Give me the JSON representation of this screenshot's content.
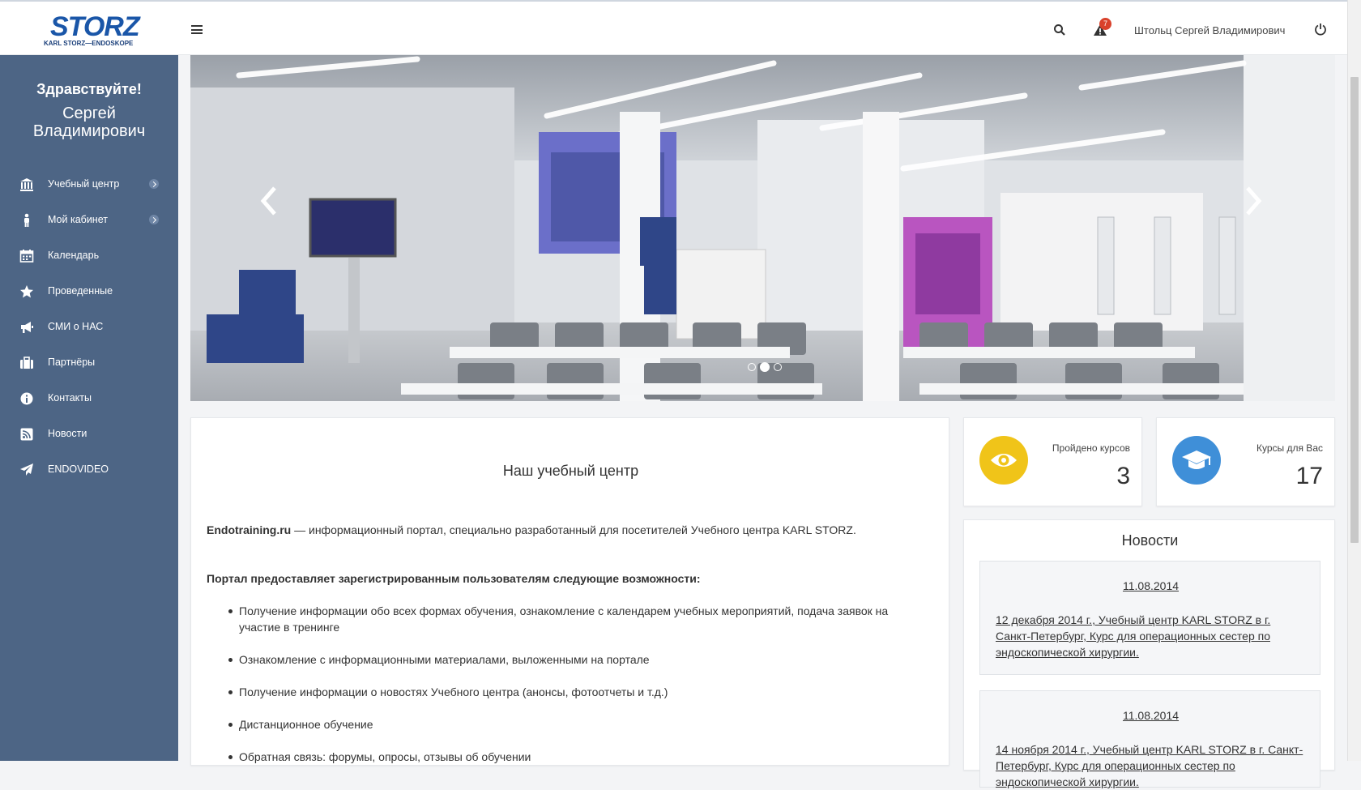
{
  "header": {
    "logo_text": "STORZ",
    "logo_subtext": "KARL STORZ—ENDOSKOPE",
    "alert_count": "7",
    "user_name": "Штольц Сергей Владимирович"
  },
  "sidebar": {
    "greeting": "Здравствуйте!",
    "name": "Сергей Владимирович",
    "items": [
      {
        "label": "Учебный центр",
        "icon": "bank-icon",
        "has_submenu": true
      },
      {
        "label": "Мой кабинет",
        "icon": "person-icon",
        "has_submenu": true
      },
      {
        "label": "Календарь",
        "icon": "calendar-icon",
        "has_submenu": false
      },
      {
        "label": "Проведенные",
        "icon": "star-icon",
        "has_submenu": false
      },
      {
        "label": "СМИ о НАС",
        "icon": "megaphone-icon",
        "has_submenu": false
      },
      {
        "label": "Партнёры",
        "icon": "briefcase-icon",
        "has_submenu": false
      },
      {
        "label": "Контакты",
        "icon": "info-icon",
        "has_submenu": false
      },
      {
        "label": "Новости",
        "icon": "rss-icon",
        "has_submenu": false
      },
      {
        "label": "ENDOVIDEO",
        "icon": "paper-plane-icon",
        "has_submenu": false
      }
    ]
  },
  "slider": {
    "slides": 3,
    "active_slide": 2
  },
  "about": {
    "title": "Наш учебный центр",
    "intro_brand": "Endotraining.ru",
    "intro_text": " — информационный портал, специально разработанный для посетителей Учебного центра KARL STORZ.",
    "lead": "Портал предоставляет зарегистрированным пользователям следующие возможности:",
    "features": [
      "Получение информации обо всех формах обучения, ознакомление с календарем учебных мероприятий, подача заявок на участие в тренинге",
      "Ознакомление с информационными материалами, выложенными на портале",
      "Получение информации о новостях Учебного центра (анонсы, фотоотчеты и т.д.)",
      "Дистанционное обучение",
      "Обратная связь: форумы, опросы, отзывы об обучении"
    ]
  },
  "stats": {
    "completed": {
      "label": "Пройдено курсов",
      "value": "3",
      "color": "#f0c419"
    },
    "for_you": {
      "label": "Курсы для Вас",
      "value": "17",
      "color": "#3f8fd8"
    }
  },
  "news": {
    "title": "Новости",
    "items": [
      {
        "date": "11.08.2014",
        "text": "12 декабря 2014 г., Учебный центр KARL STORZ в г. Санкт-Петербург, Курс для операционных сестер по эндоскопической хирургии."
      },
      {
        "date": "11.08.2014",
        "text": "14 ноября 2014 г., Учебный центр KARL STORZ в г. Санкт-Петербург, Курс для операционных сестер по эндоскопической хирургии."
      }
    ]
  },
  "colors": {
    "sidebar_bg": "#4d6585",
    "accent_yellow": "#f0c419",
    "accent_blue": "#3f8fd8",
    "alert_red": "#d9412b"
  }
}
